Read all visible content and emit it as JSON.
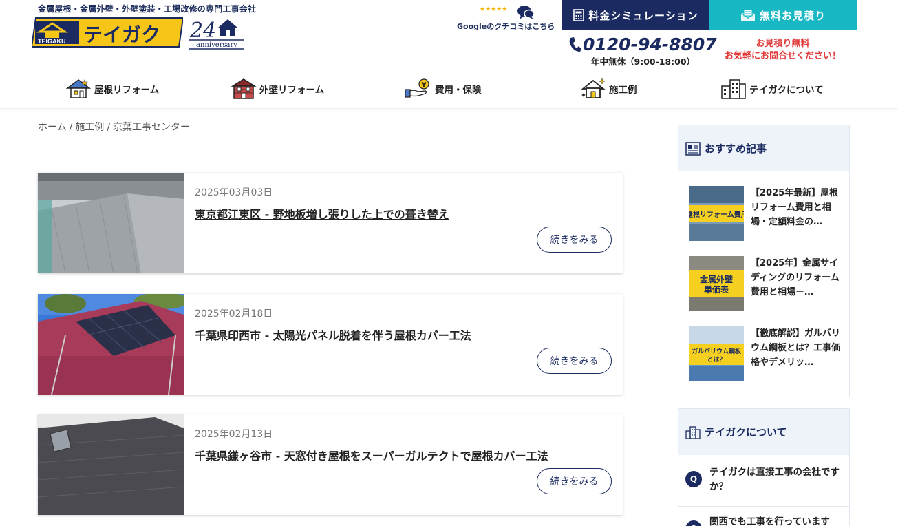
{
  "header": {
    "tagline": "金属屋根・金属外壁・外壁塗装・工場改修の専門工事会社",
    "logo_text": "テイガク",
    "logo_sub": "TEIGAKU",
    "anniversary_num": "24",
    "anniversary_word": "anniversary",
    "review_stars": "★★★★★",
    "review_label": "Googleのクチコミはこちら",
    "sim_button": "料金シミュレーション",
    "estimate_button": "無料お見積り",
    "phone": "0120-94-8807",
    "hours": "年中無休（9:00-18:00）",
    "free_line1": "お見積り無料",
    "free_line2": "お気軽にお問合せください！"
  },
  "nav": [
    {
      "label": "屋根リフォーム",
      "icon": "roof-house-icon"
    },
    {
      "label": "外壁リフォーム",
      "icon": "wall-house-icon"
    },
    {
      "label": "費用・保険",
      "icon": "yen-hand-icon"
    },
    {
      "label": "施工例",
      "icon": "sparkle-house-icon"
    },
    {
      "label": "テイガクについて",
      "icon": "building-icon"
    }
  ],
  "breadcrumb": {
    "home": "ホーム",
    "sep": "/",
    "cases": "施工例",
    "current": "京葉工事センター"
  },
  "cases": [
    {
      "date": "2025年03月03日",
      "title": "東京都江東区 - 野地板増し張りした上での葺き替え",
      "more": "続きをみる"
    },
    {
      "date": "2025年02月18日",
      "title": "千葉県印西市 - 太陽光パネル脱着を伴う屋根カバー工法",
      "more": "続きをみる"
    },
    {
      "date": "2025年02月13日",
      "title": "千葉県鎌ヶ谷市 - 天窓付き屋根をスーパーガルテクトで屋根カバー工法",
      "more": "続きをみる"
    }
  ],
  "sidebar": {
    "recommend_title": "おすすめ記事",
    "recommend": [
      {
        "title": "【2025年最新】屋根リフォーム費用と相場・定額料金の…",
        "thumb_text": "屋根リフォーム費用"
      },
      {
        "title": "【2025年】金属サイディングのリフォーム費用と相場－…",
        "thumb_text": "金属外壁\n単価表"
      },
      {
        "title": "【徹底解説】ガルバリウム鋼板とは？工事価格やデメリッ…",
        "thumb_text": "ガルバリウム鋼板\nとは？"
      }
    ],
    "about_title": "テイガクについて",
    "faq_marker": "Q",
    "faq": [
      {
        "text": "テイガクは直接工事の会社ですか？"
      },
      {
        "text": "関西でも工事を行っています"
      }
    ]
  },
  "colors": {
    "navy": "#1b2b61",
    "teal": "#17b8c4",
    "red": "#e13a3a",
    "logo_yellow": "#f5c518"
  }
}
